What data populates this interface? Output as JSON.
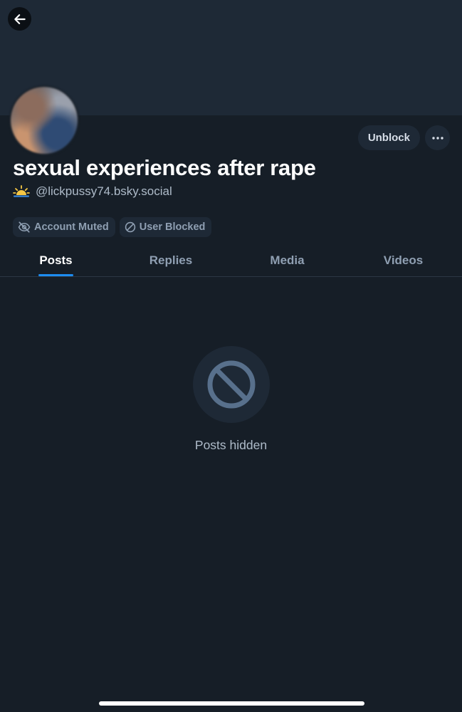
{
  "header": {
    "back_icon": "arrow-left-icon"
  },
  "profile": {
    "display_name": "sexual experiences after rape",
    "handle": "@lickpussy74.bsky.social",
    "handle_prefix_icon": "sunrise-icon",
    "avatar": "blurred-avatar"
  },
  "actions": {
    "unblock_label": "Unblock",
    "more_icon": "ellipsis-icon"
  },
  "badges": [
    {
      "label": "Account Muted",
      "icon": "eye-slash-icon"
    },
    {
      "label": "User Blocked",
      "icon": "block-icon"
    }
  ],
  "tabs": [
    {
      "label": "Posts",
      "active": true
    },
    {
      "label": "Replies",
      "active": false
    },
    {
      "label": "Media",
      "active": false
    },
    {
      "label": "Videos",
      "active": false
    }
  ],
  "empty_state": {
    "icon": "block-icon",
    "message": "Posts hidden"
  },
  "colors": {
    "background": "#161e27",
    "banner": "#1e2936",
    "accent": "#1d8cf0",
    "muted_text": "#8f9fb2"
  }
}
